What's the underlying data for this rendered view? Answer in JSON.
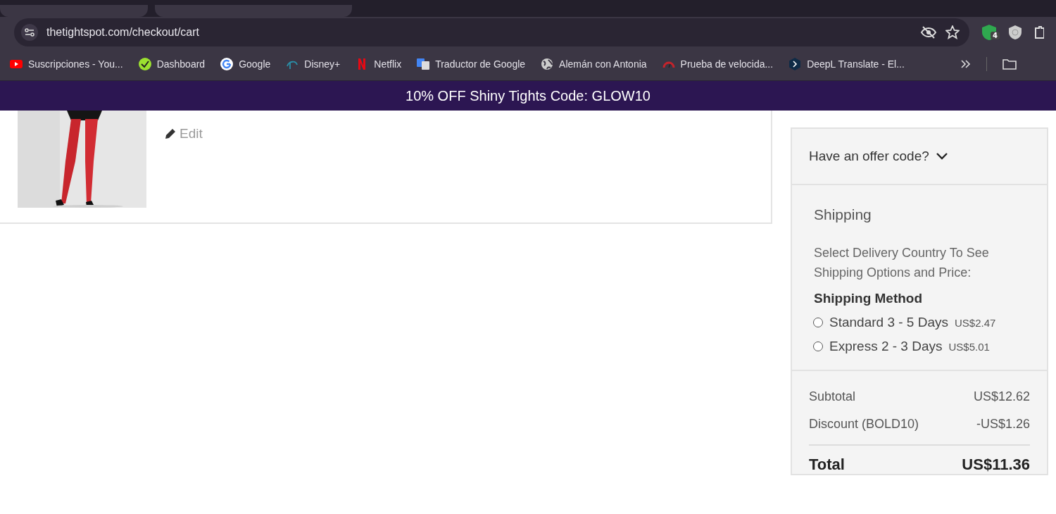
{
  "browser": {
    "address": "thetightspot.com/checkout/cart",
    "extension_badge": "4",
    "bookmarks": [
      {
        "kind": "youtube",
        "label": "Suscripciones - You..."
      },
      {
        "kind": "dashboard",
        "label": "Dashboard"
      },
      {
        "kind": "google",
        "label": "Google"
      },
      {
        "kind": "disney",
        "label": "Disney+"
      },
      {
        "kind": "netflix",
        "label": "Netflix"
      },
      {
        "kind": "translate",
        "label": "Traductor de Google"
      },
      {
        "kind": "globe",
        "label": "Alemán con Antonia"
      },
      {
        "kind": "gauge",
        "label": "Prueba de velocida..."
      },
      {
        "kind": "deepl",
        "label": "DeepL Translate - El..."
      }
    ]
  },
  "banner": {
    "text": "10% OFF Shiny Tights Code: GLOW10"
  },
  "cart_item": {
    "edit": "Edit"
  },
  "offer": {
    "label": "Have an offer code?",
    "expanded": false
  },
  "shipping": {
    "title": "Shipping",
    "note": "Select Delivery Country To See Shipping Options and Price:",
    "method_title": "Shipping Method",
    "options": [
      {
        "label": "Standard 3 - 5 Days",
        "price": "US$2.47",
        "selected": false
      },
      {
        "label": "Express 2 - 3 Days",
        "price": "US$5.01",
        "selected": false
      }
    ]
  },
  "totals": {
    "rows": [
      {
        "label": "Subtotal",
        "value": "US$12.62"
      },
      {
        "label": "Discount (BOLD10)",
        "value": "-US$1.26"
      }
    ],
    "total": {
      "label": "Total",
      "value": "US$11.36"
    }
  }
}
